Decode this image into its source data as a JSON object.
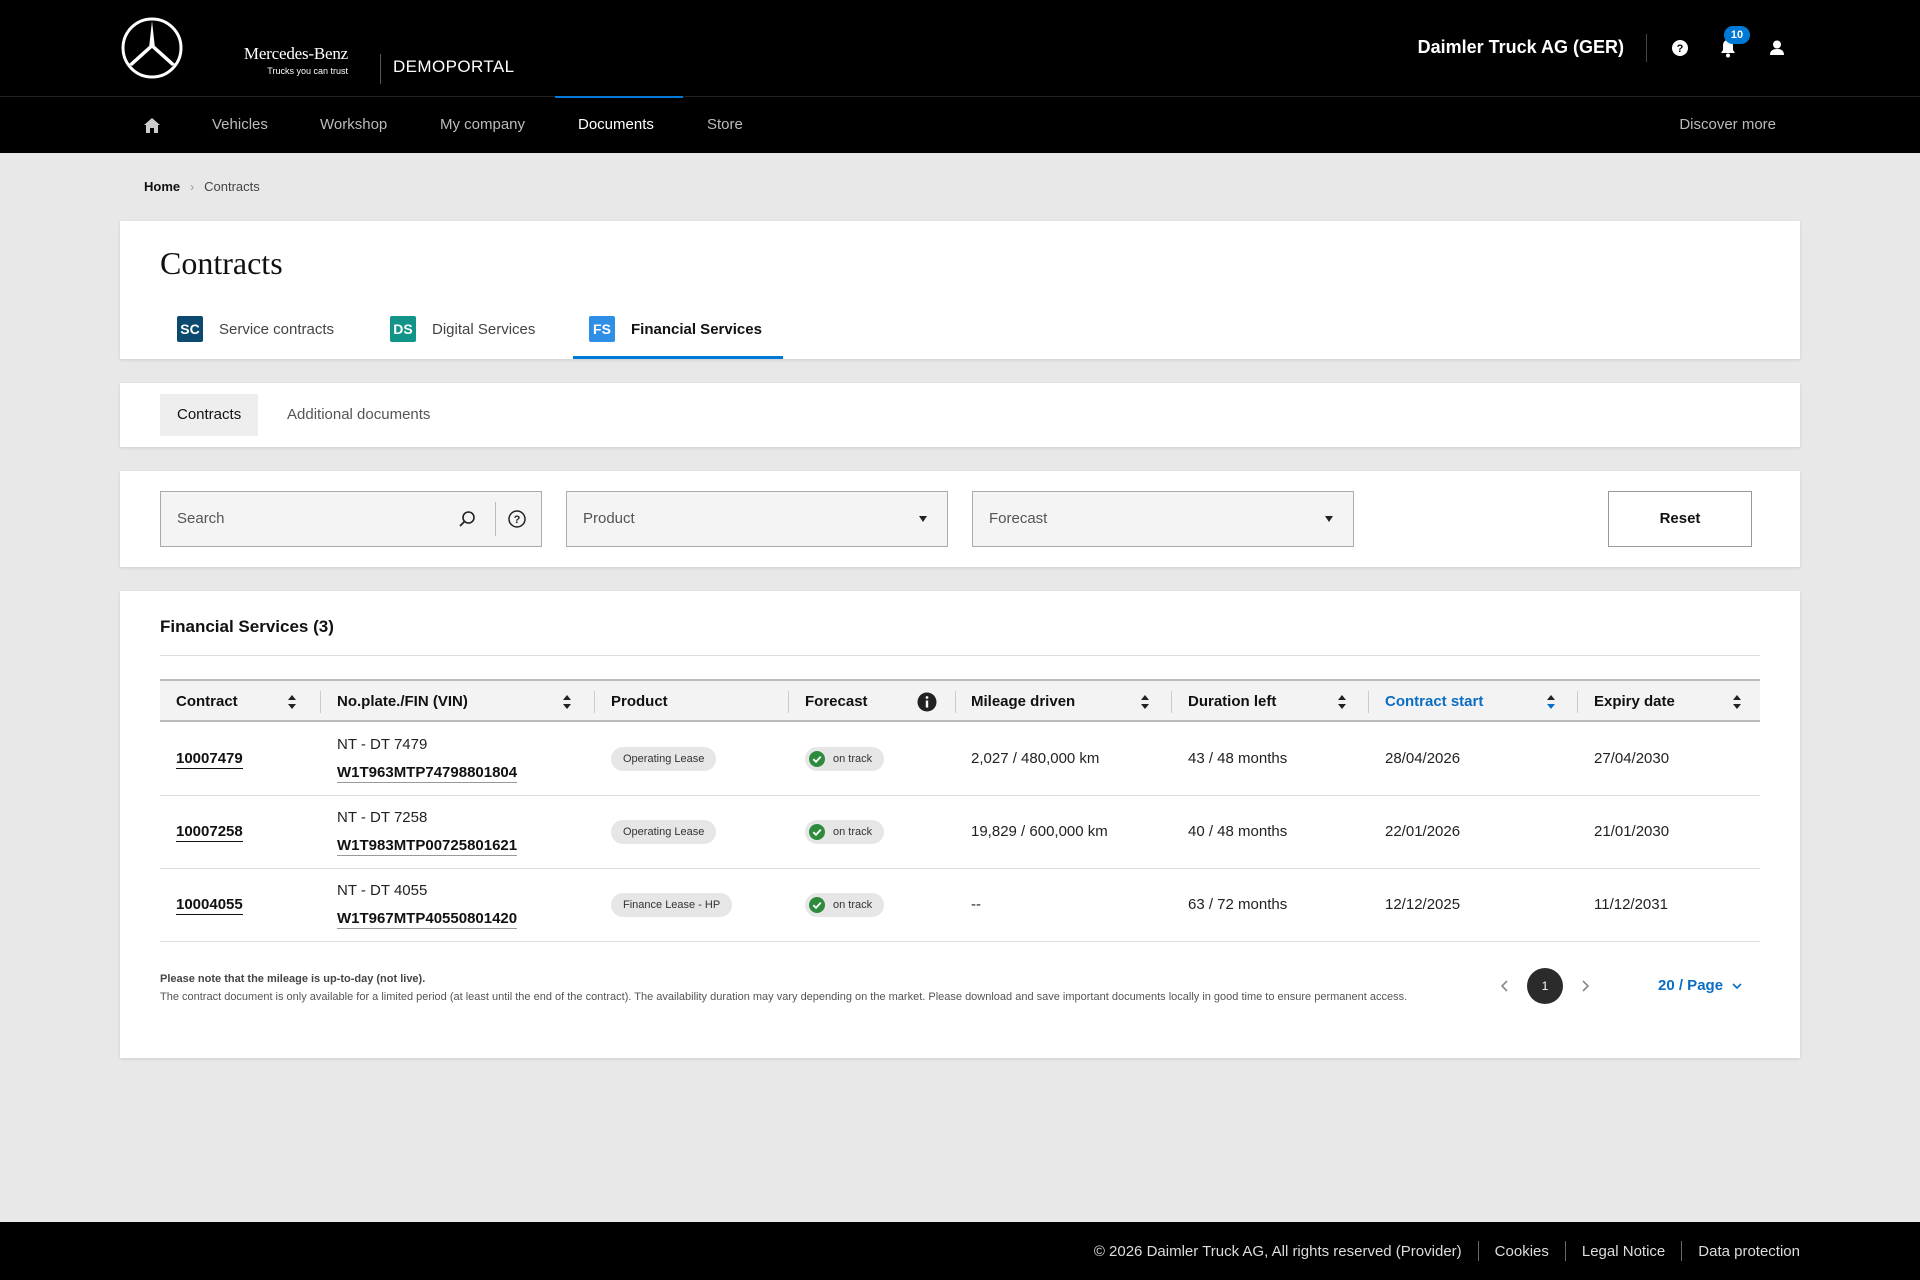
{
  "header": {
    "brand_name": "Mercedes-Benz",
    "brand_tagline": "Trucks you can trust",
    "portal_name": "DEMOPORTAL",
    "company": "Daimler Truck AG (GER)",
    "notification_count": "10"
  },
  "nav": {
    "items": [
      {
        "label": "Vehicles"
      },
      {
        "label": "Workshop"
      },
      {
        "label": "My company"
      },
      {
        "label": "Documents"
      },
      {
        "label": "Store"
      }
    ],
    "active": "Documents",
    "discover": "Discover more"
  },
  "breadcrumb": {
    "home": "Home",
    "current": "Contracts"
  },
  "page": {
    "title": "Contracts",
    "tabs": [
      {
        "badge": "SC",
        "label": "Service contracts",
        "color": "#0b4a6e"
      },
      {
        "badge": "DS",
        "label": "Digital Services",
        "color": "#139488"
      },
      {
        "badge": "FS",
        "label": "Financial Services",
        "color": "#2f8fe6"
      }
    ],
    "active_tab": "Financial Services",
    "subtabs": [
      {
        "label": "Contracts"
      },
      {
        "label": "Additional documents"
      }
    ]
  },
  "filters": {
    "search_placeholder": "Search",
    "product_placeholder": "Product",
    "forecast_placeholder": "Forecast",
    "reset_label": "Reset"
  },
  "table": {
    "title": "Financial Services (3)",
    "columns": [
      "Contract",
      "No.plate./FIN (VIN)",
      "Product",
      "Forecast",
      "Mileage driven",
      "Duration left",
      "Contract start",
      "Expiry date"
    ],
    "sorted_column": "Contract start",
    "rows": [
      {
        "contract": "10007479",
        "plate": "NT - DT 7479",
        "vin": "W1T963MTP74798801804",
        "product": "Operating Lease",
        "forecast": "on track",
        "mileage": "2,027 / 480,000 km",
        "duration": "43 / 48 months",
        "start": "28/04/2026",
        "expiry": "27/04/2030"
      },
      {
        "contract": "10007258",
        "plate": "NT - DT 7258",
        "vin": "W1T983MTP00725801621",
        "product": "Operating Lease",
        "forecast": "on track",
        "mileage": "19,829 / 600,000 km",
        "duration": "40 / 48 months",
        "start": "22/01/2026",
        "expiry": "21/01/2030"
      },
      {
        "contract": "10004055",
        "plate": "NT - DT 4055",
        "vin": "W1T967MTP40550801420",
        "product": "Finance Lease - HP",
        "forecast": "on track",
        "mileage": "--",
        "duration": "63 / 72 months",
        "start": "12/12/2025",
        "expiry": "11/12/2031"
      }
    ],
    "note_bold": "Please note that the mileage is up-to-day (not live).",
    "note": "The contract document is only available for a limited period (at least until the end of the contract). The availability duration may vary depending on the market. Please download and save important documents locally in good time to ensure permanent access.",
    "current_page": "1",
    "per_page": "20 / Page"
  },
  "footer": {
    "copyright": "© 2026 Daimler Truck AG, All rights reserved (Provider)",
    "links": [
      "Cookies",
      "Legal Notice",
      "Data protection"
    ]
  },
  "colors": {
    "accent": "#0078d6",
    "link": "#0a6ec4",
    "status_ok": "#2e8b3e"
  }
}
